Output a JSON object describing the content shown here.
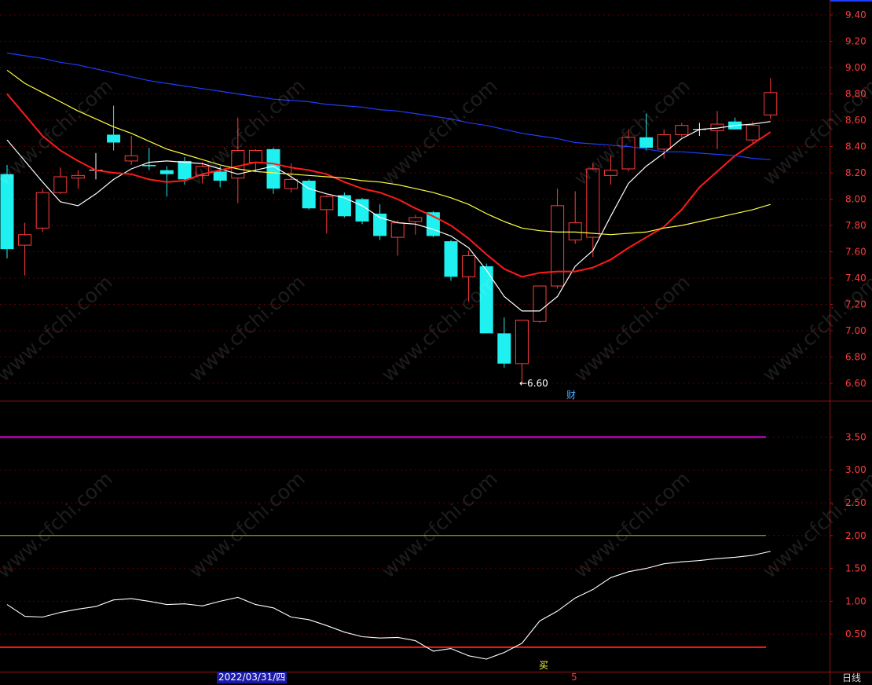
{
  "chart_data": [
    {
      "type": "candlestick",
      "period": "日线",
      "date_marker": "2022/03/31/四",
      "axis_marker": "5",
      "ylim": [
        6.5,
        9.5
      ],
      "yticks": [
        "6.60",
        "6.80",
        "7.00",
        "7.20",
        "7.40",
        "7.60",
        "7.80",
        "8.00",
        "8.20",
        "8.40",
        "8.60",
        "8.80",
        "9.00",
        "9.20",
        "9.40"
      ],
      "low_marker": "←6.60",
      "event_marker": "财",
      "candles": [
        {
          "o": 7.62,
          "h": 8.26,
          "l": 7.55,
          "c": 8.19,
          "dir": "down"
        },
        {
          "o": 7.65,
          "h": 7.82,
          "l": 7.42,
          "c": 7.73,
          "dir": "up"
        },
        {
          "o": 7.78,
          "h": 8.08,
          "l": 7.75,
          "c": 8.05,
          "dir": "up"
        },
        {
          "o": 8.05,
          "h": 8.24,
          "l": 8.04,
          "c": 8.17,
          "dir": "up"
        },
        {
          "o": 8.16,
          "h": 8.22,
          "l": 8.08,
          "c": 8.18,
          "dir": "up"
        },
        {
          "o": 8.22,
          "h": 8.35,
          "l": 8.15,
          "c": 8.22,
          "dir": "flat"
        },
        {
          "o": 8.49,
          "h": 8.71,
          "l": 8.37,
          "c": 8.43,
          "dir": "down"
        },
        {
          "o": 8.29,
          "h": 8.48,
          "l": 8.26,
          "c": 8.33,
          "dir": "up"
        },
        {
          "o": 8.26,
          "h": 8.39,
          "l": 8.22,
          "c": 8.25,
          "dir": "down"
        },
        {
          "o": 8.22,
          "h": 8.25,
          "l": 8.02,
          "c": 8.19,
          "dir": "down"
        },
        {
          "o": 8.29,
          "h": 8.32,
          "l": 8.11,
          "c": 8.15,
          "dir": "down"
        },
        {
          "o": 8.18,
          "h": 8.28,
          "l": 8.12,
          "c": 8.25,
          "dir": "up"
        },
        {
          "o": 8.21,
          "h": 8.25,
          "l": 8.09,
          "c": 8.14,
          "dir": "down"
        },
        {
          "o": 8.16,
          "h": 8.62,
          "l": 7.97,
          "c": 8.37,
          "dir": "up"
        },
        {
          "o": 8.28,
          "h": 8.38,
          "l": 8.21,
          "c": 8.37,
          "dir": "up"
        },
        {
          "o": 8.38,
          "h": 8.39,
          "l": 8.04,
          "c": 8.08,
          "dir": "down"
        },
        {
          "o": 8.08,
          "h": 8.27,
          "l": 8.05,
          "c": 8.15,
          "dir": "up"
        },
        {
          "o": 8.14,
          "h": 8.15,
          "l": 7.92,
          "c": 7.93,
          "dir": "down"
        },
        {
          "o": 7.92,
          "h": 8.03,
          "l": 7.74,
          "c": 8.02,
          "dir": "up"
        },
        {
          "o": 8.03,
          "h": 8.05,
          "l": 7.86,
          "c": 7.87,
          "dir": "down"
        },
        {
          "o": 8.0,
          "h": 8.01,
          "l": 7.81,
          "c": 7.83,
          "dir": "down"
        },
        {
          "o": 7.89,
          "h": 7.96,
          "l": 7.69,
          "c": 7.72,
          "dir": "down"
        },
        {
          "o": 7.71,
          "h": 7.84,
          "l": 7.57,
          "c": 7.82,
          "dir": "up"
        },
        {
          "o": 7.83,
          "h": 7.88,
          "l": 7.73,
          "c": 7.86,
          "dir": "up"
        },
        {
          "o": 7.9,
          "h": 7.91,
          "l": 7.71,
          "c": 7.72,
          "dir": "down"
        },
        {
          "o": 7.68,
          "h": 7.69,
          "l": 7.38,
          "c": 7.41,
          "dir": "down"
        },
        {
          "o": 7.41,
          "h": 7.61,
          "l": 7.22,
          "c": 7.57,
          "dir": "up"
        },
        {
          "o": 7.49,
          "h": 7.51,
          "l": 6.98,
          "c": 6.98,
          "dir": "down"
        },
        {
          "o": 6.98,
          "h": 7.1,
          "l": 6.72,
          "c": 6.75,
          "dir": "down"
        },
        {
          "o": 6.75,
          "h": 7.08,
          "l": 6.6,
          "c": 7.08,
          "dir": "up"
        },
        {
          "o": 7.07,
          "h": 7.34,
          "l": 7.06,
          "c": 7.34,
          "dir": "up"
        },
        {
          "o": 7.34,
          "h": 8.08,
          "l": 7.32,
          "c": 7.95,
          "dir": "up"
        },
        {
          "o": 7.69,
          "h": 8.06,
          "l": 7.66,
          "c": 7.82,
          "dir": "up"
        },
        {
          "o": 7.71,
          "h": 8.27,
          "l": 7.56,
          "c": 8.23,
          "dir": "up"
        },
        {
          "o": 8.18,
          "h": 8.33,
          "l": 8.11,
          "c": 8.22,
          "dir": "up"
        },
        {
          "o": 8.23,
          "h": 8.53,
          "l": 8.21,
          "c": 8.47,
          "dir": "up"
        },
        {
          "o": 8.47,
          "h": 8.65,
          "l": 8.37,
          "c": 8.39,
          "dir": "down"
        },
        {
          "o": 8.38,
          "h": 8.53,
          "l": 8.31,
          "c": 8.49,
          "dir": "up"
        },
        {
          "o": 8.49,
          "h": 8.58,
          "l": 8.47,
          "c": 8.56,
          "dir": "up"
        },
        {
          "o": 8.53,
          "h": 8.58,
          "l": 8.48,
          "c": 8.53,
          "dir": "flat"
        },
        {
          "o": 8.52,
          "h": 8.67,
          "l": 8.38,
          "c": 8.57,
          "dir": "up"
        },
        {
          "o": 8.59,
          "h": 8.62,
          "l": 8.53,
          "c": 8.53,
          "dir": "down"
        },
        {
          "o": 8.45,
          "h": 8.59,
          "l": 8.42,
          "c": 8.56,
          "dir": "up"
        },
        {
          "o": 8.64,
          "h": 8.92,
          "l": 8.61,
          "c": 8.81,
          "dir": "up"
        }
      ],
      "moving_averages": [
        {
          "color": "#ffffff",
          "values": [
            8.45,
            8.29,
            8.13,
            7.98,
            7.95,
            8.04,
            8.15,
            8.23,
            8.28,
            8.29,
            8.28,
            8.27,
            8.23,
            8.19,
            8.22,
            8.25,
            8.17,
            8.08,
            8.04,
            8.01,
            7.95,
            7.86,
            7.82,
            7.81,
            7.77,
            7.72,
            7.63,
            7.46,
            7.26,
            7.15,
            7.15,
            7.26,
            7.49,
            7.61,
            7.87,
            8.12,
            8.25,
            8.35,
            8.46,
            8.53,
            8.54,
            8.56,
            8.57,
            8.59
          ]
        },
        {
          "color": "#ff1a1a",
          "values": [
            8.8,
            8.64,
            8.48,
            8.37,
            8.29,
            8.22,
            8.2,
            8.19,
            8.15,
            8.13,
            8.14,
            8.19,
            8.22,
            8.25,
            8.28,
            8.27,
            8.24,
            8.22,
            8.19,
            8.13,
            8.08,
            8.05,
            8.0,
            7.93,
            7.87,
            7.8,
            7.7,
            7.58,
            7.47,
            7.41,
            7.44,
            7.45,
            7.45,
            7.48,
            7.54,
            7.63,
            7.71,
            7.79,
            7.92,
            8.09,
            8.21,
            8.33,
            8.42,
            8.51
          ]
        },
        {
          "color": "#ffff40",
          "values": [
            8.98,
            8.88,
            8.81,
            8.74,
            8.67,
            8.61,
            8.55,
            8.5,
            8.44,
            8.38,
            8.34,
            8.3,
            8.26,
            8.23,
            8.21,
            8.2,
            8.19,
            8.18,
            8.17,
            8.16,
            8.14,
            8.13,
            8.11,
            8.08,
            8.05,
            8.01,
            7.96,
            7.89,
            7.83,
            7.78,
            7.76,
            7.75,
            7.75,
            7.74,
            7.73,
            7.74,
            7.75,
            7.78,
            7.8,
            7.83,
            7.86,
            7.89,
            7.92,
            7.96
          ]
        },
        {
          "color": "#1f3cff",
          "values": [
            9.11,
            9.09,
            9.07,
            9.04,
            9.02,
            8.99,
            8.96,
            8.93,
            8.9,
            8.88,
            8.86,
            8.84,
            8.82,
            8.8,
            8.78,
            8.76,
            8.75,
            8.74,
            8.72,
            8.71,
            8.7,
            8.68,
            8.67,
            8.65,
            8.63,
            8.61,
            8.58,
            8.56,
            8.53,
            8.5,
            8.48,
            8.46,
            8.43,
            8.42,
            8.41,
            8.4,
            8.38,
            8.36,
            8.36,
            8.35,
            8.34,
            8.33,
            8.31,
            8.3
          ]
        }
      ]
    },
    {
      "type": "line",
      "ylim": [
        0.2,
        4.0
      ],
      "yticks": [
        "0.50",
        "1.00",
        "1.50",
        "2.00",
        "2.50",
        "3.00",
        "3.50"
      ],
      "signal_marker": "买",
      "reference_lines": [
        {
          "value": 3.5,
          "color": "#e000e0"
        },
        {
          "value": 2.0,
          "color": "#b0b000"
        },
        {
          "value": 0.3,
          "color": "#ff1a1a"
        }
      ],
      "series": [
        {
          "color": "#ffffff",
          "values": [
            0.95,
            0.77,
            0.76,
            0.83,
            0.88,
            0.92,
            1.02,
            1.04,
            1.0,
            0.95,
            0.96,
            0.93,
            1.0,
            1.06,
            0.95,
            0.9,
            0.76,
            0.72,
            0.63,
            0.53,
            0.46,
            0.44,
            0.45,
            0.4,
            0.24,
            0.28,
            0.17,
            0.12,
            0.22,
            0.36,
            0.7,
            0.85,
            1.05,
            1.18,
            1.36,
            1.45,
            1.5,
            1.57,
            1.6,
            1.62,
            1.65,
            1.67,
            1.7,
            1.76
          ]
        }
      ]
    }
  ]
}
